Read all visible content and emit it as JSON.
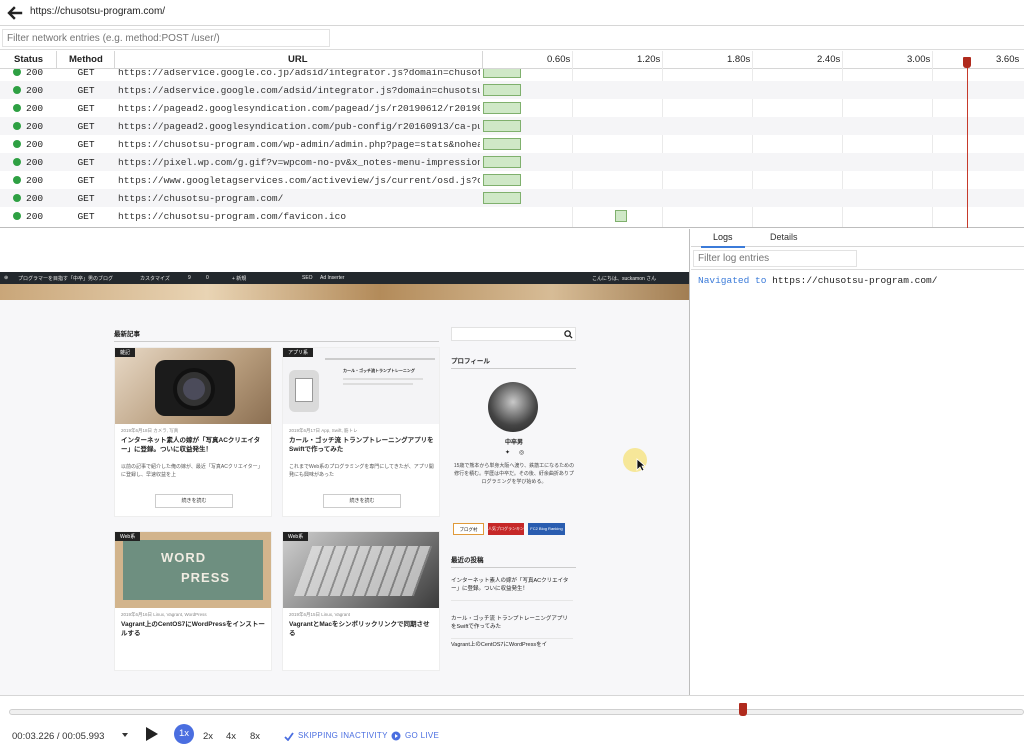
{
  "topbar": {
    "url": "https://chusotsu-program.com/"
  },
  "network": {
    "filter_placeholder": "Filter network entries (e.g. method:POST /user/)",
    "columns": {
      "status": "Status",
      "method": "Method",
      "url": "URL"
    },
    "ticks": [
      "0.60s",
      "1.20s",
      "1.80s",
      "2.40s",
      "3.00s",
      "3.60s"
    ],
    "rows": [
      {
        "status": "200",
        "method": "GET",
        "url": "https://adservice.google.co.jp/adsid/integrator.js?domain=chusotsu-",
        "start": 0.0,
        "duration": 0.25
      },
      {
        "status": "200",
        "method": "GET",
        "url": "https://adservice.google.com/adsid/integrator.js?domain=chusotsu-pr",
        "start": 0.0,
        "duration": 0.25
      },
      {
        "status": "200",
        "method": "GET",
        "url": "https://pagead2.googlesyndication.com/pagead/js/r20190612/r20190131",
        "start": 0.0,
        "duration": 0.25
      },
      {
        "status": "200",
        "method": "GET",
        "url": "https://pagead2.googlesyndication.com/pub-config/r20160913/ca-pub-7",
        "start": 0.0,
        "duration": 0.25
      },
      {
        "status": "200",
        "method": "GET",
        "url": "https://chusotsu-program.com/wp-admin/admin.php?page=stats&noheader",
        "start": 0.0,
        "duration": 0.25
      },
      {
        "status": "200",
        "method": "GET",
        "url": "https://pixel.wp.com/g.gif?v=wpcom-no-pv&x_notes-menu-impressions=z",
        "start": 0.0,
        "duration": 0.25
      },
      {
        "status": "200",
        "method": "GET",
        "url": "https://www.googletagservices.com/activeview/js/current/osd.js?cb=%",
        "start": 0.0,
        "duration": 0.25
      },
      {
        "status": "200",
        "method": "GET",
        "url": "https://chusotsu-program.com/",
        "start": 0.0,
        "duration": 0.25
      },
      {
        "status": "200",
        "method": "GET",
        "url": "https://chusotsu-program.com/favicon.ico",
        "start": 0.88,
        "duration": 0.08
      }
    ]
  },
  "preview": {
    "admin_bar": {
      "site": "プログラマーを目指す「中卒」男のブログ",
      "customize": "カスタマイズ",
      "updates": "9",
      "comments": "0",
      "new": "+ 新規",
      "seo": "SEO",
      "ad": "Ad Inserter",
      "greeting": "こんにちは、suckamon さん"
    },
    "recent_heading": "最新記事",
    "search_icon": "search-icon",
    "profile_heading": "プロフィール",
    "profile_name": "中卒男",
    "profile_bio": "15歳で熊本から単身大阪へ渡り、鉄筋工になるための修行を積む。学歴は中卒だ。その後、紆余曲折ありプログラミングを学び始める。",
    "recent_posts_heading": "最近の投稿",
    "recent_posts": [
      "インターネット素人の嫁が「写真ACクリエイター」に登録。ついに収益発生！",
      "カール・ゴッチ流 トランプトレーニングアプリをSwiftで作ってみた",
      "Vagrant上のCentOS7にWordPressをイ"
    ],
    "badges": [
      "ブログ村",
      "人気ブログランキング",
      "FC2 Blog Ranking"
    ],
    "cards": [
      {
        "badge": "雑記",
        "date": "2019年6月18日  カメラ, 写真",
        "title": "インターネット素人の嫁が「写真ACクリエイター」に登録。ついに収益発生！",
        "excerpt": "以前の記事で紹介した俺の嫁が、最近「写真ACクリエイター」に登録し、早速収益を上",
        "button": "続きを読む"
      },
      {
        "badge": "アプリ系",
        "date": "2019年6月17日  App, Swift, 筋トレ",
        "title": "カール・ゴッチ流 トランプトレーニングアプリをSwiftで作ってみた",
        "excerpt": "これまでWeb系のプログラミングを専門にしてきたが、アプリ開発にも興味があった",
        "button": "続きを読む",
        "screen_title": "カール・ゴッチ流トランプトレーニング"
      },
      {
        "badge": "Web系",
        "date": "2019年6月16日  Linux, Vagrant, WordPress",
        "title": "Vagrant上のCentOS7にWordPressをインストールする",
        "img_text1": "WORD",
        "img_text2": "PRESS"
      },
      {
        "badge": "Web系",
        "date": "2019年6月15日  Linux, Vagrant",
        "title": "VagrantとMacをシンボリックリンクで同期させる"
      }
    ]
  },
  "logs": {
    "tabs": [
      "Logs",
      "Details"
    ],
    "filter_placeholder": "Filter log entries",
    "entry_keyword": "Navigated to",
    "entry_url": "https://chusotsu-program.com/"
  },
  "player": {
    "timecode": "00:03.226 / 00:05.993",
    "progress": 0.538,
    "speeds": [
      "1x",
      "2x",
      "4x",
      "8x"
    ],
    "active_speed": "1x",
    "skip_label": "SKIPPING INACTIVITY",
    "live_label": "GO LIVE"
  },
  "colors": {
    "accent": "#4a6ee0",
    "playhead": "#b02a1d",
    "ok_dot": "#2ea043",
    "bar_fill": "#cfe8c7"
  }
}
